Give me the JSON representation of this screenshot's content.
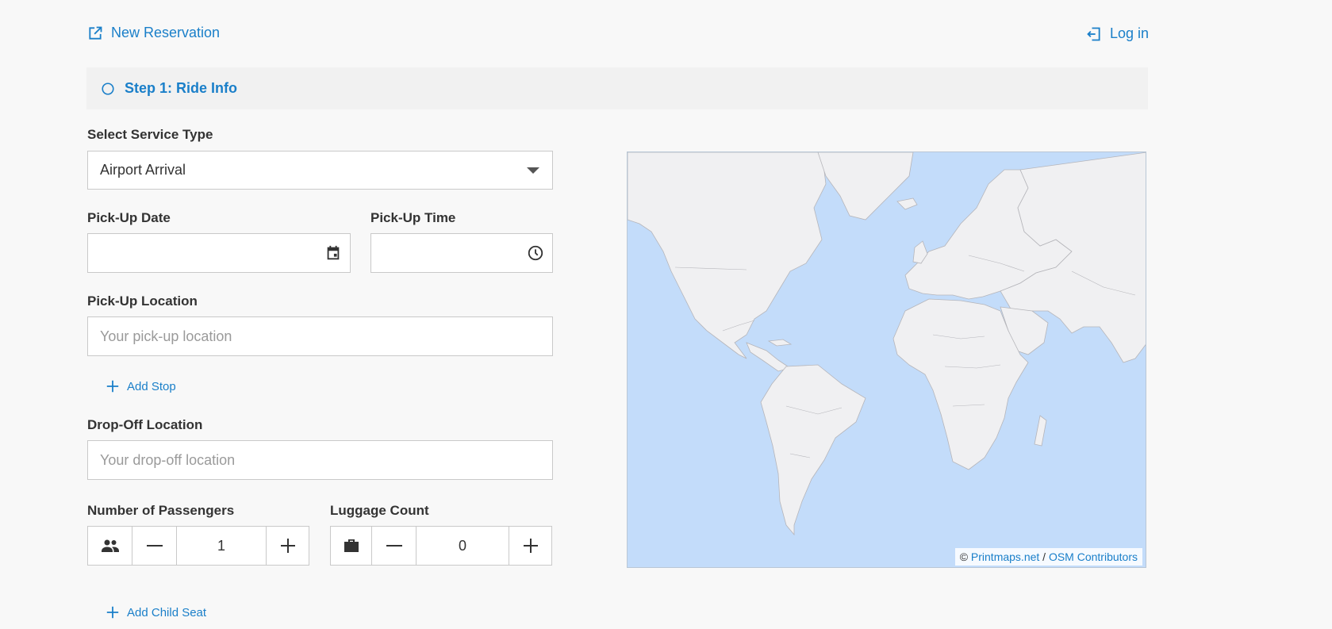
{
  "header": {
    "new_reservation": "New Reservation",
    "login": "Log in"
  },
  "step": {
    "title": "Step 1: Ride Info"
  },
  "form": {
    "service_type": {
      "label": "Select Service Type",
      "value": "Airport Arrival"
    },
    "pickup_date": {
      "label": "Pick-Up Date",
      "value": ""
    },
    "pickup_time": {
      "label": "Pick-Up Time",
      "value": ""
    },
    "pickup_location": {
      "label": "Pick-Up Location",
      "placeholder": "Your pick-up location"
    },
    "add_stop": "Add Stop",
    "dropoff_location": {
      "label": "Drop-Off Location",
      "placeholder": "Your drop-off location"
    },
    "passengers": {
      "label": "Number of Passengers",
      "value": "1"
    },
    "luggage": {
      "label": "Luggage Count",
      "value": "0"
    },
    "add_child_seat": "Add Child Seat"
  },
  "map": {
    "attribution_prefix": "©",
    "attribution_link1": "Printmaps.net",
    "attribution_sep": "/",
    "attribution_link2": "OSM Contributors"
  },
  "colors": {
    "accent": "#1a7fc9",
    "ocean": "#c3dcfa",
    "land": "#f0f0f2"
  },
  "icons": {
    "new_reservation": "external-link-icon",
    "login": "login-icon",
    "step": "circle-outline-icon",
    "date": "calendar-icon",
    "time": "clock-icon",
    "add": "plus-icon",
    "passengers": "people-icon",
    "luggage": "suitcase-icon",
    "decrement": "minus-icon",
    "increment": "plus-icon"
  }
}
